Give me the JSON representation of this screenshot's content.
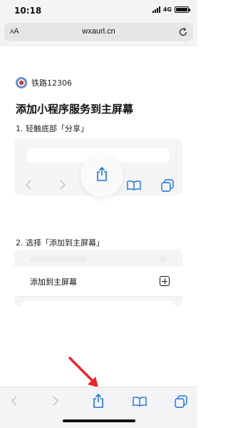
{
  "status": {
    "time": "10:18",
    "network": "4G",
    "battery_level": 1.0
  },
  "browser": {
    "text_size_label_small": "A",
    "text_size_label_large": "A",
    "url": "wxaurl.cn"
  },
  "page": {
    "app_name": "铁路12306",
    "title": "添加小程序服务到主屏幕",
    "step1": "1. 轻触底部「分享」",
    "step2": "2. 选择「添加到主屏幕」",
    "add_to_home_label": "添加到主屏幕"
  },
  "icons": [
    "back-icon",
    "forward-icon",
    "share-icon",
    "bookmarks-icon",
    "tabs-icon",
    "reload-icon",
    "plus-square-icon"
  ],
  "colors": {
    "accent": "#1a73d9",
    "arrow": "#e8262a",
    "inactive": "#c6c6cc"
  }
}
